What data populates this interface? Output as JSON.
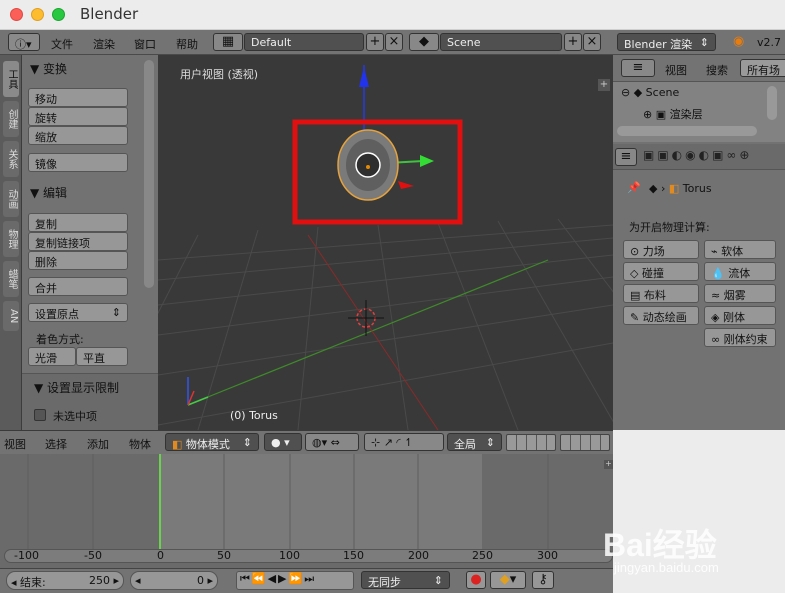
{
  "window": {
    "title": "Blender"
  },
  "topbar": {
    "menus": [
      "文件",
      "渲染",
      "窗口",
      "帮助"
    ],
    "layout": "Default",
    "scene": "Scene",
    "engine": "Blender 渲染",
    "version": "v2.7"
  },
  "lefttabs": [
    "工具",
    "创建",
    "关系",
    "动画",
    "物理",
    "蜡笔",
    "AN"
  ],
  "tools": {
    "transform_header": "变换",
    "move": "移动",
    "rotate": "旋转",
    "scale": "缩放",
    "mirror": "镜像",
    "edit_header": "编辑",
    "duplicate": "复制",
    "duplicate_linked": "复制链接项",
    "delete": "删除",
    "join": "合并",
    "set_origin": "设置原点",
    "shading_label": "着色方式:",
    "smooth": "光滑",
    "flat": "平直",
    "display_header": "设置显示限制",
    "unselected": "未选中项"
  },
  "viewport": {
    "view_label": "用户视图 (透视)",
    "object_label": "(0) Torus",
    "highlight_color": "#e01010"
  },
  "outliner": {
    "view": "视图",
    "search": "搜索",
    "all_scenes": "所有场",
    "scene": "Scene",
    "render_layers": "渲染层"
  },
  "properties": {
    "object": "Torus",
    "physics_label": "为开启物理计算:",
    "buttons": [
      "力场",
      "软体",
      "碰撞",
      "流体",
      "布料",
      "烟雾",
      "动态绘画",
      "刚体",
      "刚体约束"
    ]
  },
  "header3d": {
    "menus": [
      "视图",
      "选择",
      "添加",
      "物体"
    ],
    "mode": "物体模式",
    "global": "全局"
  },
  "timeline": {
    "ticks": [
      "-100",
      "-50",
      "0",
      "50",
      "100",
      "150",
      "200",
      "250",
      "300"
    ],
    "current_frame_color": "#6ad24e"
  },
  "bottom": {
    "end_label": "结束:",
    "end_value": "250",
    "frame_value": "0",
    "sync": "无同步"
  },
  "watermark": {
    "text": "Bai经验",
    "url": "jingyan.baidu.com"
  }
}
